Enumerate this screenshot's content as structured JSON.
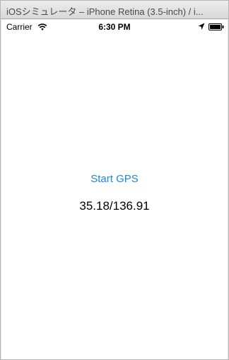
{
  "window": {
    "title": "iOSシミュレータ – iPhone Retina (3.5-inch) / i..."
  },
  "statusbar": {
    "carrier": "Carrier",
    "time": "6:30 PM",
    "icons": [
      "wifi-icon",
      "location-arrow-icon",
      "battery-icon"
    ]
  },
  "main": {
    "start_button_label": "Start GPS",
    "coordinates": "35.18/136.91"
  },
  "colors": {
    "accent": "#1a86e8"
  }
}
